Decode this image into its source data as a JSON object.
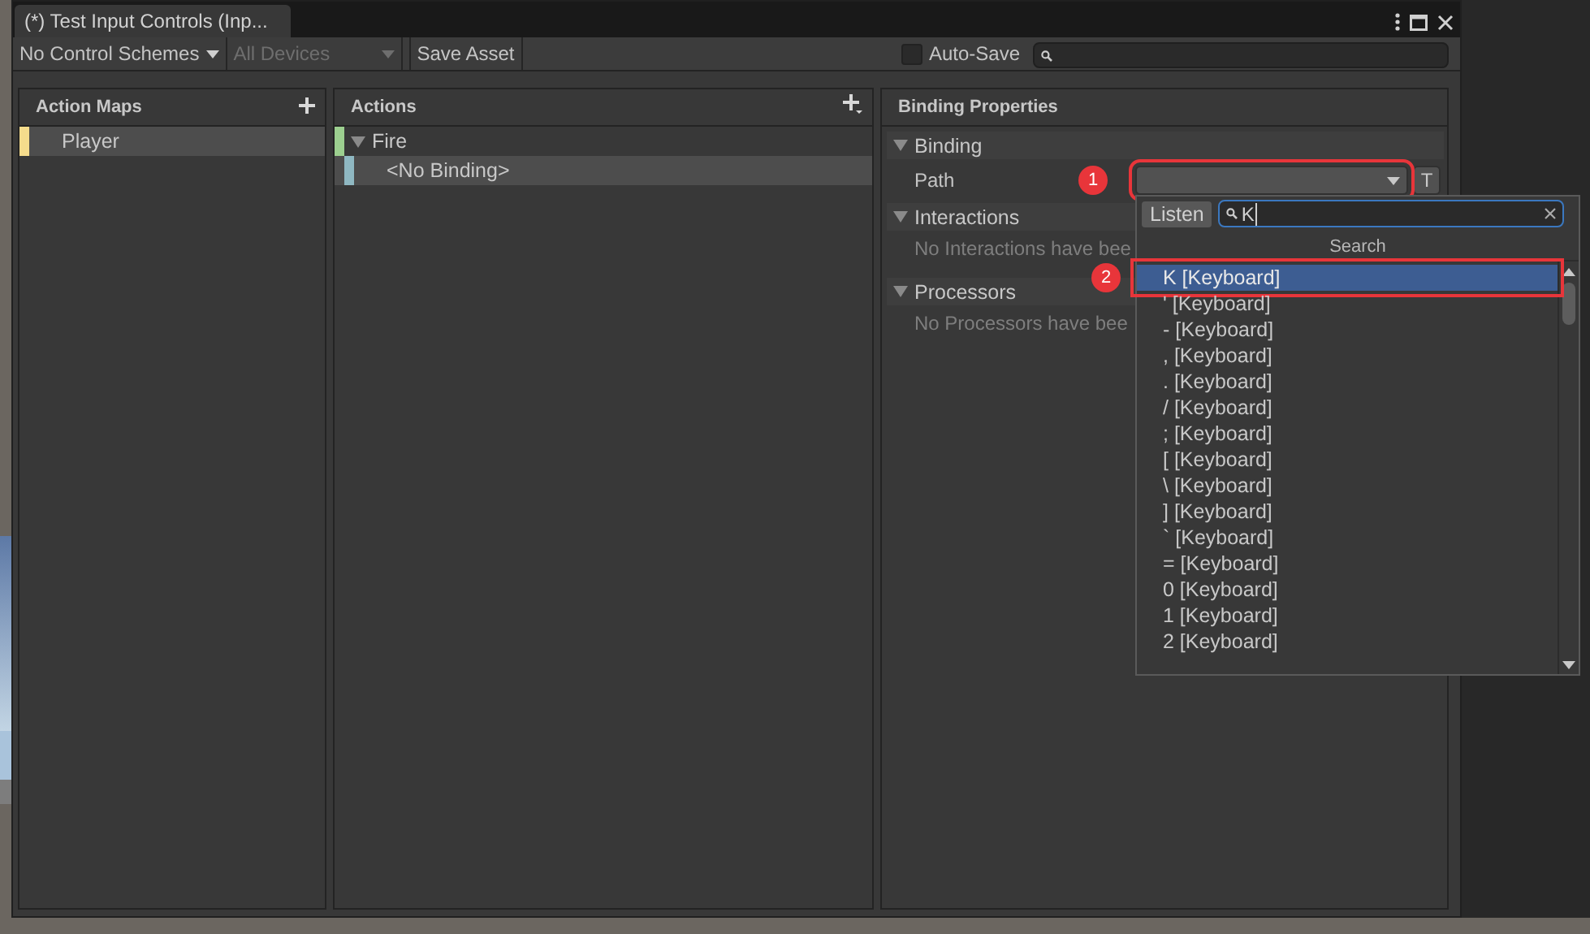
{
  "window": {
    "tab_title": "(*) Test Input Controls (Inp..."
  },
  "toolbar": {
    "control_scheme": "No Control Schemes",
    "devices": {
      "label": "All Devices",
      "disabled": true
    },
    "save_button": "Save Asset",
    "auto_save": {
      "label": "Auto-Save",
      "checked": false
    }
  },
  "action_maps": {
    "title": "Action Maps",
    "items": [
      {
        "label": "Player",
        "selected": true,
        "color": "#f5dc8c"
      }
    ]
  },
  "actions": {
    "title": "Actions",
    "items": [
      {
        "label": "Fire",
        "expanded": true,
        "selected": false,
        "color": "#9ccf8f",
        "children": [
          {
            "label": "<No Binding>",
            "selected": true,
            "color": "#8fb8c2"
          }
        ]
      }
    ]
  },
  "properties": {
    "title": "Binding Properties",
    "sections": [
      {
        "title": "Binding",
        "expanded": true,
        "kind": "path",
        "label": "Path",
        "annotation": "1",
        "t_button": "T"
      },
      {
        "title": "Interactions",
        "expanded": true,
        "kind": "message",
        "message": "No Interactions have bee"
      },
      {
        "title": "Processors",
        "expanded": true,
        "kind": "message",
        "message": "No Processors have bee"
      }
    ]
  },
  "picker": {
    "listen_button": "Listen",
    "search_value": "K",
    "heading": "Search",
    "items": [
      {
        "label": "K [Keyboard]",
        "selected": true,
        "annotation": "2"
      },
      {
        "label": "' [Keyboard]",
        "selected": false
      },
      {
        "label": "- [Keyboard]",
        "selected": false
      },
      {
        "label": ", [Keyboard]",
        "selected": false
      },
      {
        "label": ". [Keyboard]",
        "selected": false
      },
      {
        "label": "/ [Keyboard]",
        "selected": false
      },
      {
        "label": "; [Keyboard]",
        "selected": false
      },
      {
        "label": "[ [Keyboard]",
        "selected": false
      },
      {
        "label": "\\ [Keyboard]",
        "selected": false
      },
      {
        "label": "] [Keyboard]",
        "selected": false
      },
      {
        "label": "` [Keyboard]",
        "selected": false
      },
      {
        "label": "= [Keyboard]",
        "selected": false
      },
      {
        "label": "0 [Keyboard]",
        "selected": false
      },
      {
        "label": "1 [Keyboard]",
        "selected": false
      },
      {
        "label": "2 [Keyboard]",
        "selected": false
      }
    ]
  }
}
